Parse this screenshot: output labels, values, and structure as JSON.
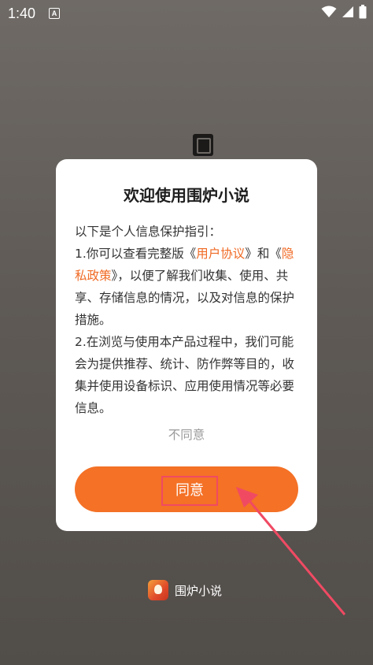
{
  "status_bar": {
    "time": "1:40",
    "notification_badge": "A"
  },
  "dialog": {
    "title": "欢迎使用围炉小说",
    "intro": "以下是个人信息保护指引：",
    "line1_prefix": "1.你可以查看完整版《",
    "user_agreement": "用户协议",
    "line1_mid": "》和《",
    "privacy_policy": "隐私政策",
    "line1_suffix": "》，以便了解我们收集、使用、共享、存储信息的情况，以及对信息的保护措施。",
    "line2": "2.在浏览与使用本产品过程中，我们可能会为提供推荐、统计、防作弊等目的，收集并使用设备标识、应用使用情况等必要信息。",
    "disagree_label": "不同意",
    "agree_label": "同意"
  },
  "brand": {
    "name": "围炉小说"
  },
  "colors": {
    "accent": "#f47126",
    "link": "#f06a24",
    "highlight_box": "#f04a63"
  }
}
